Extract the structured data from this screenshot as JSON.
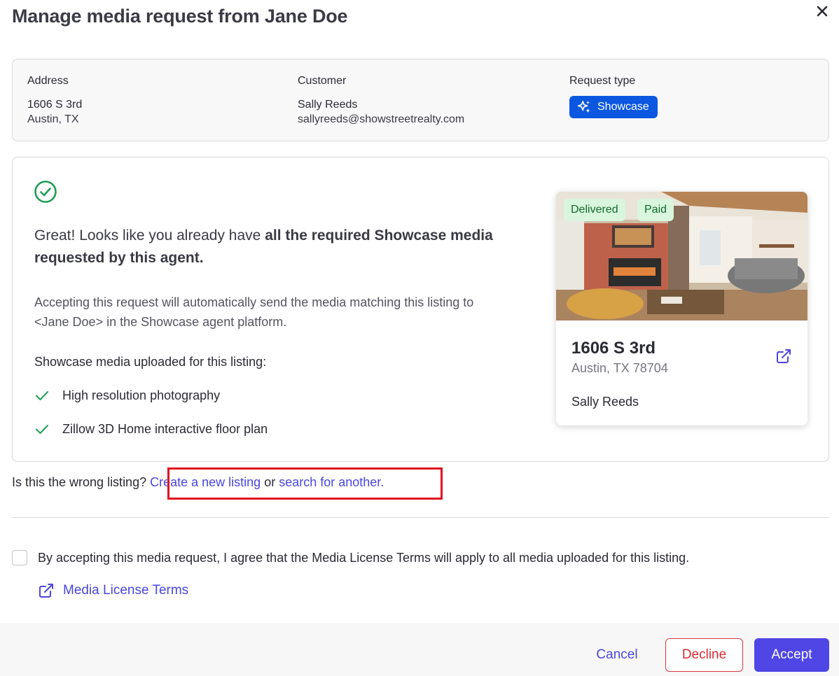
{
  "modal": {
    "title": "Manage media request from Jane Doe"
  },
  "info": {
    "address": {
      "label": "Address",
      "line1": "1606 S 3rd",
      "line2": "Austin, TX"
    },
    "customer": {
      "label": "Customer",
      "name": "Sally Reeds",
      "email": "sallyreeds@showstreetrealty.com"
    },
    "request_type": {
      "label": "Request type",
      "value": "Showcase"
    }
  },
  "content": {
    "headline_prefix": "Great! Looks like you already have ",
    "headline_bold": "all the required Showcase media requested by this agent.",
    "description": "Accepting this request will automatically send the media matching this listing to <Jane Doe> in the Showcase agent platform.",
    "media_title": "Showcase media uploaded for this listing:",
    "media_items": [
      "High resolution photography",
      "Zillow 3D Home interactive floor plan"
    ]
  },
  "card": {
    "badges": [
      "Delivered",
      "Paid"
    ],
    "address": "1606 S 3rd",
    "city": "Austin, TX 78704",
    "agent": "Sally Reeds"
  },
  "wrong_listing": {
    "prompt": "Is this the wrong listing? ",
    "create_link": "Create a new listing",
    "or_text": " or ",
    "search_link": "search for another."
  },
  "agreement": {
    "text": "By accepting this media request, I agree that the Media License Terms will apply to all media uploaded for this listing.",
    "terms_link": "Media License Terms",
    "checked": false
  },
  "footer": {
    "cancel": "Cancel",
    "decline": "Decline",
    "accept": "Accept"
  },
  "colors": {
    "accent": "#4f46e5",
    "showcase_badge": "#0b57e0",
    "success": "#1f9d55",
    "decline": "#d62b31",
    "highlight": "#e0101e"
  }
}
